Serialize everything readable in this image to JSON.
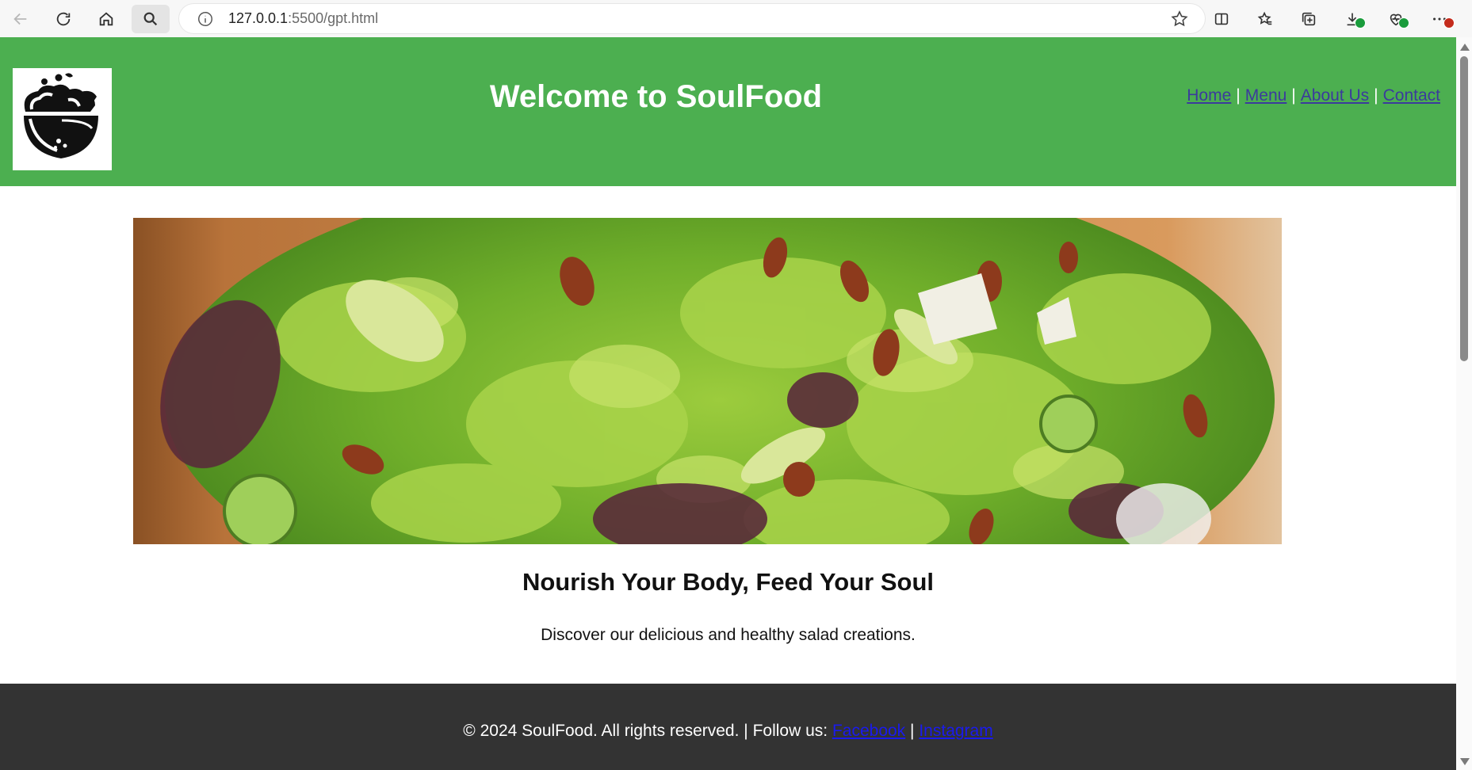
{
  "browser": {
    "url_host": "127.0.0.1",
    "url_path": ":5500/gpt.html"
  },
  "header": {
    "title": "Welcome to SoulFood",
    "nav": [
      {
        "label": "Home"
      },
      {
        "label": "Menu"
      },
      {
        "label": "About Us"
      },
      {
        "label": "Contact"
      }
    ],
    "separator": "|"
  },
  "main": {
    "tagline": "Nourish Your Body, Feed Your Soul",
    "description": "Discover our delicious and healthy salad creations."
  },
  "footer": {
    "text": "© 2024 SoulFood. All rights reserved. | Follow us:",
    "links": [
      {
        "label": "Facebook"
      },
      {
        "label": "Instagram"
      }
    ],
    "separator": "|"
  },
  "colors": {
    "header_bg": "#4caf50",
    "footer_bg": "#333333",
    "nav_link": "#3b3b9c",
    "footer_link": "#1a1aee"
  }
}
